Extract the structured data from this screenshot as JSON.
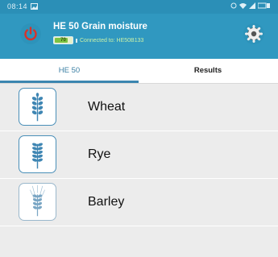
{
  "status_bar": {
    "time": "08:14"
  },
  "header": {
    "title": "HE 50 Grain moisture",
    "battery_label": "70",
    "connection_text": "Connected to: HE50B133"
  },
  "tabs": [
    {
      "label": "HE 50",
      "active": true
    },
    {
      "label": "Results",
      "active": false
    }
  ],
  "grains": [
    {
      "label": "Wheat",
      "icon": "wheat-icon"
    },
    {
      "label": "Rye",
      "icon": "rye-icon"
    },
    {
      "label": "Barley",
      "icon": "barley-icon"
    }
  ],
  "colors": {
    "header": "#3098c0",
    "status_bar": "#2b8fb7",
    "power_red": "#d8322a",
    "accent": "#3b86b0",
    "list_bg": "#ececec"
  }
}
